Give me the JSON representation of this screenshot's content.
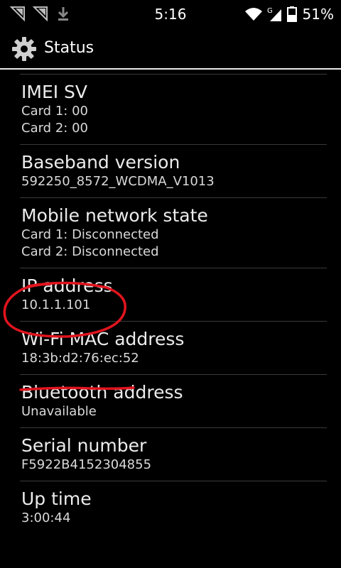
{
  "status_bar": {
    "time": "5:16",
    "battery_percent": "51%",
    "icons_left": [
      "notification-flag-icon",
      "notification-flag-icon",
      "download-icon"
    ],
    "icons_right": [
      "wifi-icon",
      "signal-g-icon",
      "signal-icon",
      "battery-icon"
    ],
    "network_label": "G"
  },
  "action_bar": {
    "title": "Status",
    "icon": "gear-icon"
  },
  "items": [
    {
      "title": "IMEI SV",
      "lines": [
        "Card 1: 00",
        "Card 2: 00"
      ]
    },
    {
      "title": "Baseband version",
      "lines": [
        "592250_8572_WCDMA_V1013"
      ]
    },
    {
      "title": "Mobile network state",
      "lines": [
        "Card 1: Disconnected",
        "Card 2: Disconnected"
      ]
    },
    {
      "title": "IP address",
      "lines": [
        "10.1.1.101"
      ]
    },
    {
      "title": "Wi-Fi MAC address",
      "lines": [
        "18:3b:d2:76:ec:52"
      ]
    },
    {
      "title": "Bluetooth address",
      "lines": [
        "Unavailable"
      ]
    },
    {
      "title": "Serial number",
      "lines": [
        "F5922B4152304855"
      ]
    },
    {
      "title": "Up time",
      "lines": [
        "3:00:44"
      ]
    }
  ],
  "colors": {
    "background": "#000000",
    "annotation": "#e0141e",
    "divider": "#3a3a3a"
  }
}
